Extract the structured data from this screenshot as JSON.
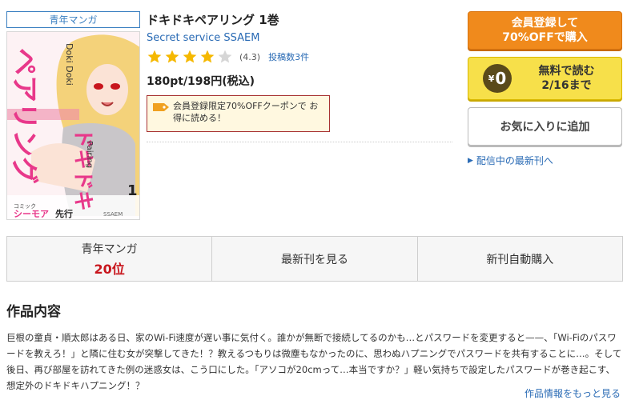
{
  "book": {
    "genre_tag": "青年マンガ",
    "title": "ドキドキペアリング 1巻",
    "author": "Secret service SSAEM",
    "rating_value": 4.3,
    "rating_text": "(4.3)",
    "reviews": "投稿数3件",
    "price": "180pt/198円(税込)",
    "coupon_text": "会員登録限定70%OFFクーポンで お得に読める！",
    "cover": {
      "title_text": "ペアリング",
      "title_text_2": "ドキドキ",
      "doki_latin": "Doki Doki",
      "pairing_latin": "Pairing",
      "volume": "1",
      "label": "コミックシーモア 先行",
      "label_brand": "シーモア",
      "label_small": "コミック",
      "label_sakko": "先行",
      "author_small": "SSAEM"
    }
  },
  "actions": {
    "register_label_1": "会員登録して",
    "register_label_2": "70%OFFで購入",
    "free_symbol": "¥",
    "free_zero": "0",
    "free_label_1": "無料で読む",
    "free_label_2": "2/16まで",
    "favorite_label": "お気に入りに追加",
    "latest_link": "配信中の最新刊へ"
  },
  "stats": {
    "genre_label": "青年マンガ",
    "genre_rank": "20位",
    "latest_label": "最新刊を見る",
    "auto_label": "新刊自動購入"
  },
  "content": {
    "section_title": "作品内容",
    "description": "巨根の童貞・順太郎はある日、家のWi-Fi速度が遅い事に気付く。誰かが無断で接続してるのかも…とパスワードを変更すると——、「Wi-Fiのパスワードを教えろ！」と隣に住む女が突撃してきた！？教えるつもりは微塵もなかったのに、思わぬハプニングでパスワードを共有することに…。そして後日、再び部屋を訪れてきた例の迷惑女は、こう口にした。「アソコが20cmって…本当ですか？」軽い気持ちで設定したパスワードが巻き起こす、想定外のドキドキハプニング！？",
    "more_link": "作品情報をもっと見る"
  },
  "colors": {
    "accent_blue": "#2a6bb5",
    "orange": "#f08a1c",
    "yellow": "#f7e04a",
    "rank_red": "#c8161d",
    "star_gold": "#f5b800",
    "cover_pink": "#e8388a"
  },
  "icons": {
    "star": "star-icon",
    "coupon": "ticket-icon",
    "arrow": "triangle-right-icon",
    "yen": "yen-coin-icon"
  }
}
